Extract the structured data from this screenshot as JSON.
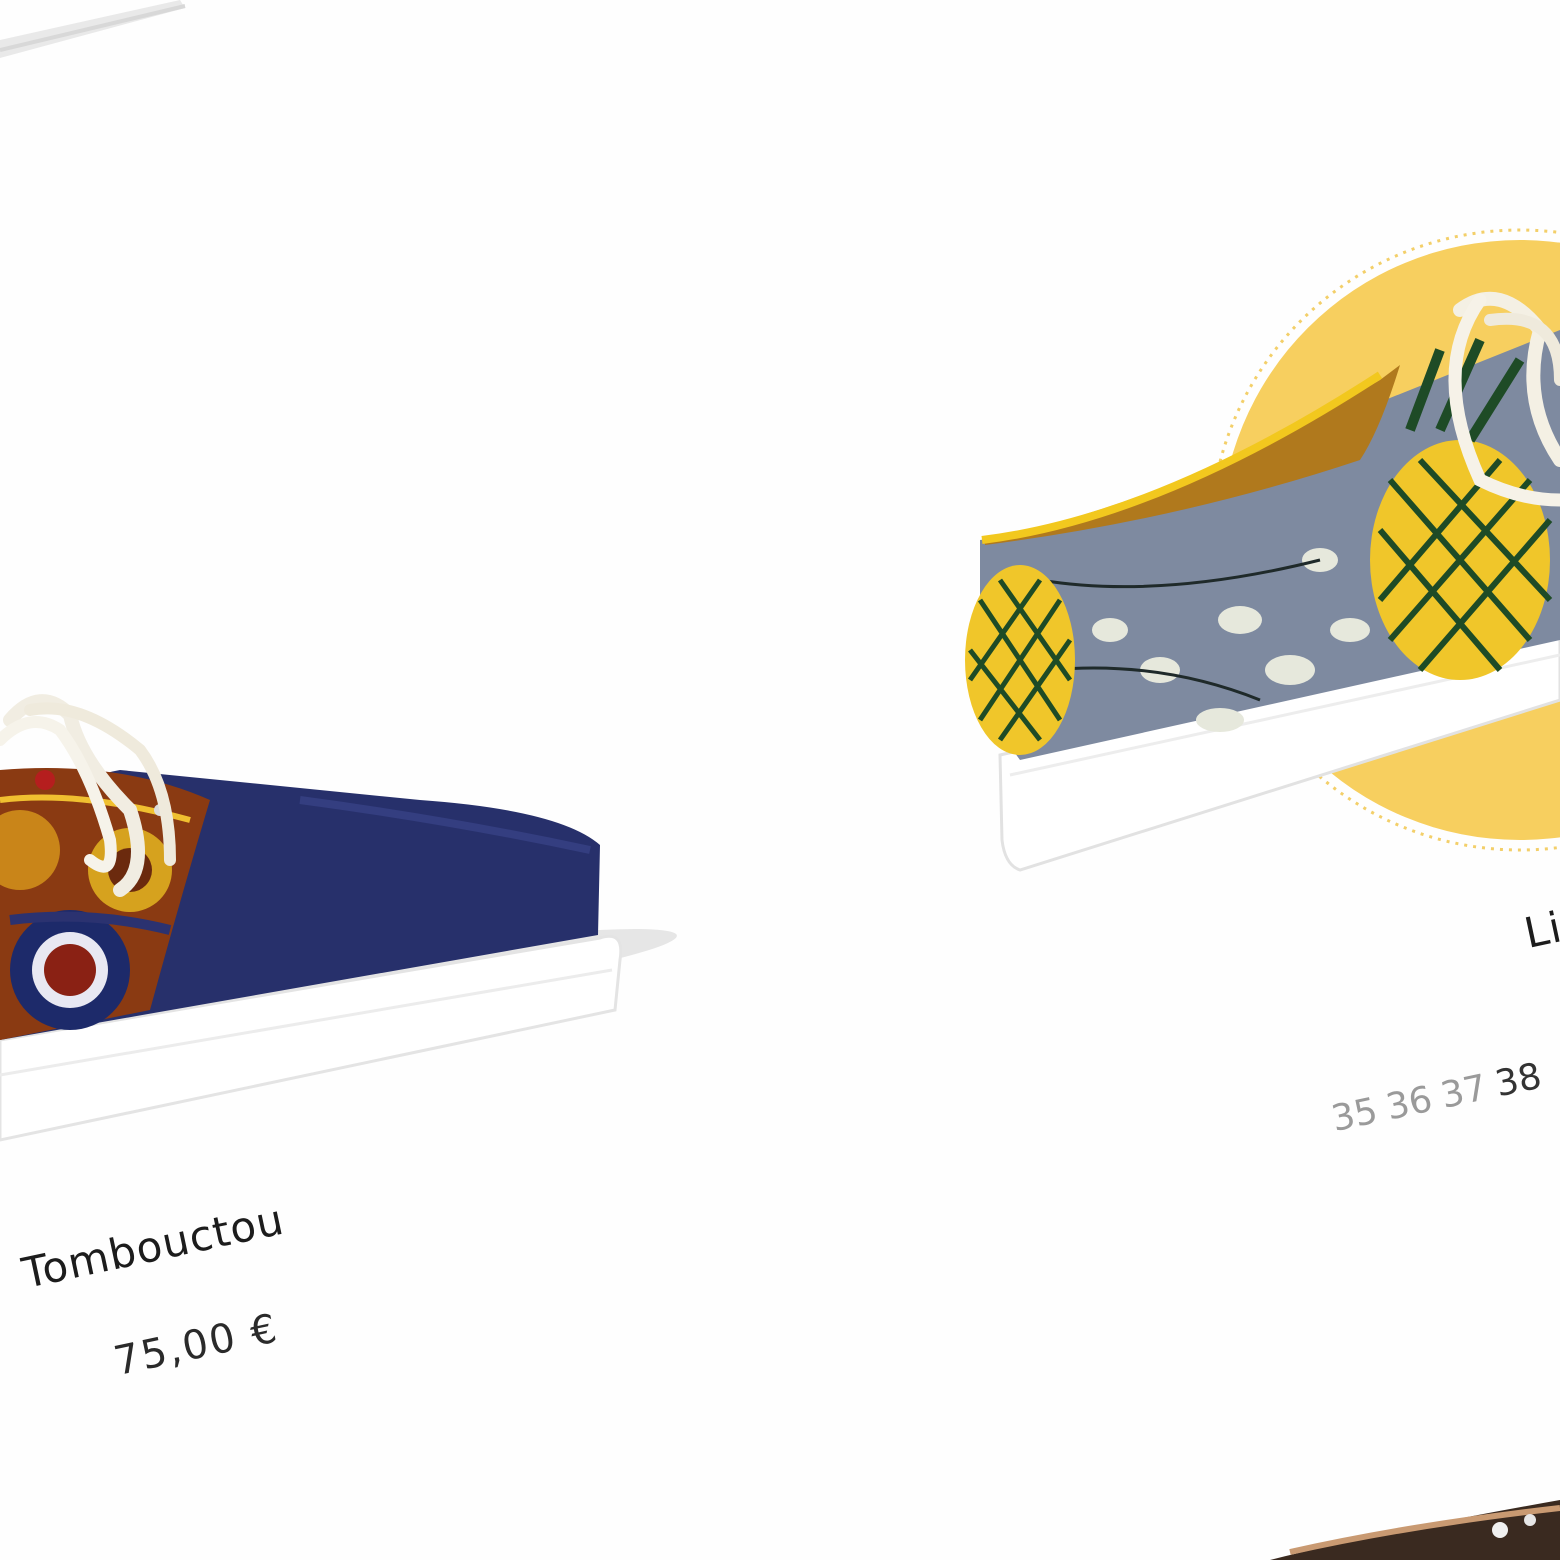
{
  "products": [
    {
      "name": "Tombouctou",
      "price": "75,00 €"
    },
    {
      "name": "Li",
      "sizes": [
        {
          "label": "35",
          "available": false
        },
        {
          "label": "36",
          "available": false
        },
        {
          "label": "37",
          "available": false
        },
        {
          "label": "38",
          "available": true
        }
      ]
    }
  ],
  "colors": {
    "accent_yellow": "#f7cf5f",
    "navy": "#27306b",
    "text_dark": "#1c1c1c",
    "text_muted": "#9a9a9a"
  }
}
